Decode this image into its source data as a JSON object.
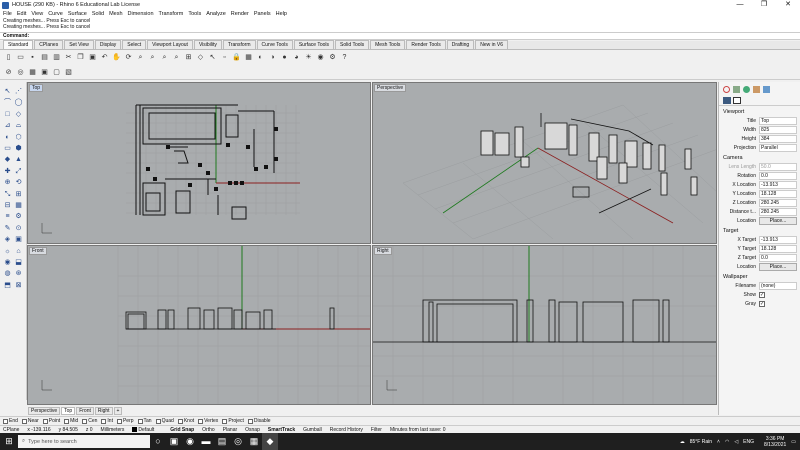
{
  "window": {
    "title": "HOUSE (290 KB) - Rhino 6 Educational Lab License",
    "minimize": "—",
    "maximize": "❐",
    "close": "✕"
  },
  "menu": [
    "File",
    "Edit",
    "View",
    "Curve",
    "Surface",
    "Solid",
    "Mesh",
    "Dimension",
    "Transform",
    "Tools",
    "Analyze",
    "Render",
    "Panels",
    "Help"
  ],
  "command_history": [
    "Creating meshes... Press Esc to cancel",
    "Creating meshes... Press Esc to cancel"
  ],
  "command_prompt": "Command:",
  "toolbar_tabs": [
    "Standard",
    "CPlanes",
    "Set View",
    "Display",
    "Select",
    "Viewport Layout",
    "Visibility",
    "Transform",
    "Curve Tools",
    "Surface Tools",
    "Solid Tools",
    "Mesh Tools",
    "Render Tools",
    "Drafting",
    "New in V6"
  ],
  "active_tab": "Standard",
  "viewports": {
    "top": "Top",
    "perspective": "Perspective",
    "front": "Front",
    "right": "Right"
  },
  "view_tabs": [
    "Perspective",
    "Top",
    "Front",
    "Right"
  ],
  "view_tab_add": "+",
  "active_view_tab": "Top",
  "osnaps": [
    "End",
    "Near",
    "Point",
    "Mid",
    "Cen",
    "Int",
    "Perp",
    "Tan",
    "Quad",
    "Knot",
    "Vertex",
    "Project",
    "Disable"
  ],
  "status": {
    "cplane": "CPlane",
    "x": "x -139.116",
    "y": "y 84.505",
    "z": "z 0",
    "units": "Millimeters",
    "layer": "Default",
    "grid_snap": "Grid Snap",
    "ortho": "Ortho",
    "planar": "Planar",
    "osnap": "Osnap",
    "smarttrack": "SmartTrack",
    "gumball": "Gumball",
    "record_history": "Record History",
    "filter": "Filter",
    "message": "Minutes from last save: 0"
  },
  "taskbar": {
    "search_placeholder": "Type here to search",
    "weather": "85°F  Rain",
    "lang": "ENG",
    "time": "3:36 PM",
    "date": "8/13/2021"
  },
  "properties": {
    "viewport_header": "Viewport",
    "title_label": "Title",
    "title_value": "Top",
    "width_label": "Width",
    "width_value": "825",
    "height_label": "Height",
    "height_value": "384",
    "projection_label": "Projection",
    "projection_value": "Parallel",
    "camera_header": "Camera",
    "lens_label": "Lens Length",
    "lens_value": "50.0",
    "rotation_label": "Rotation",
    "rotation_value": "0.0",
    "xloc_label": "X Location",
    "xloc_value": "-13.913",
    "yloc_label": "Y Location",
    "yloc_value": "18.128",
    "zloc_label": "Z Location",
    "zloc_value": "280.245",
    "dist_label": "Distance t...",
    "dist_value": "280.245",
    "location_label": "Location",
    "location_btn": "Place...",
    "target_header": "Target",
    "xt_label": "X Target",
    "xt_value": "-13.913",
    "yt_label": "Y Target",
    "yt_value": "18.128",
    "zt_label": "Z Target",
    "zt_value": "0.0",
    "tloc_label": "Location",
    "tloc_btn": "Place...",
    "wallpaper_header": "Wallpaper",
    "filename_label": "Filename",
    "filename_value": "(none)",
    "show_label": "Show",
    "show_value": "✓",
    "gray_label": "Gray",
    "gray_value": "✓"
  },
  "colors": {
    "viewport_bg": "#a9acae",
    "grid": "#9b9ea0",
    "axis_x": "#8b2020",
    "axis_y": "#1e7a1e",
    "geometry": "#111111"
  }
}
